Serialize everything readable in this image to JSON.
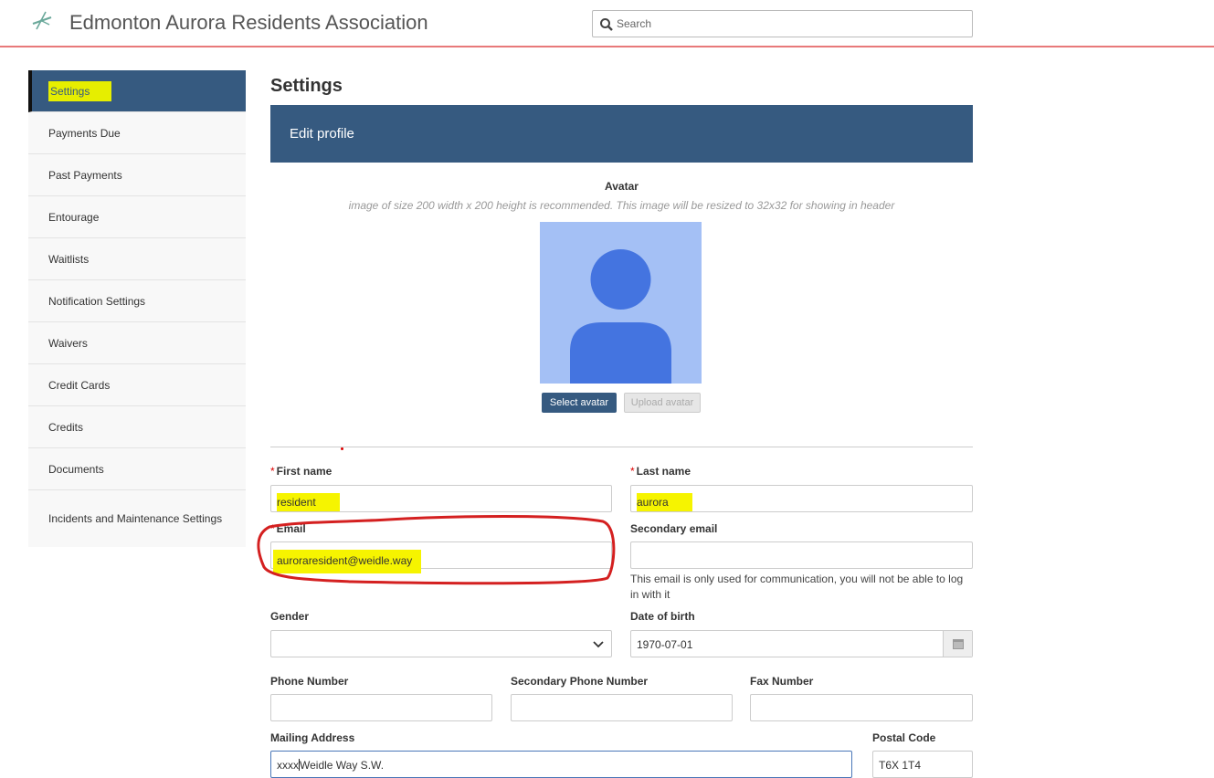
{
  "header": {
    "org_name": "Edmonton Aurora Residents Association",
    "search_placeholder": "Search"
  },
  "sidebar": {
    "items": [
      {
        "label": "Settings",
        "active": true
      },
      {
        "label": "Payments Due"
      },
      {
        "label": "Past Payments"
      },
      {
        "label": "Entourage"
      },
      {
        "label": "Waitlists"
      },
      {
        "label": "Notification Settings"
      },
      {
        "label": "Waivers"
      },
      {
        "label": "Credit Cards"
      },
      {
        "label": "Credits"
      },
      {
        "label": "Documents"
      },
      {
        "label": "Incidents and Maintenance Settings"
      }
    ]
  },
  "main": {
    "page_title": "Settings",
    "panel_title": "Edit profile",
    "avatar": {
      "title": "Avatar",
      "hint": "image of size 200 width x 200 height is recommended. This image will be resized to 32x32 for showing in header",
      "select_button": "Select avatar",
      "upload_button": "Upload avatar"
    },
    "form": {
      "required_mark": "*",
      "first_name": {
        "label": "First name",
        "value": "resident"
      },
      "last_name": {
        "label": "Last name",
        "value": "aurora"
      },
      "email": {
        "label": "Email",
        "value": "auroraresident@weidle.way"
      },
      "secondary_email": {
        "label": "Secondary email",
        "value": "",
        "help": "This email is only used for communication, you will not be able to log in with it"
      },
      "gender": {
        "label": "Gender",
        "value": ""
      },
      "date_of_birth": {
        "label": "Date of birth",
        "value": "1970-07-01"
      },
      "phone": {
        "label": "Phone Number",
        "value": ""
      },
      "secondary_phone": {
        "label": "Secondary Phone Number",
        "value": ""
      },
      "fax": {
        "label": "Fax Number",
        "value": ""
      },
      "mailing_address": {
        "label": "Mailing Address",
        "value_before_cursor": "xxxx",
        "value_after_cursor": "Weidle Way S.W."
      },
      "postal_code": {
        "label": "Postal Code",
        "value": "T6X 1T4"
      }
    }
  },
  "colors": {
    "primary": "#365a80",
    "header_rule": "#e8797a",
    "highlight": "#f6f400",
    "annotation": "#d42020"
  }
}
